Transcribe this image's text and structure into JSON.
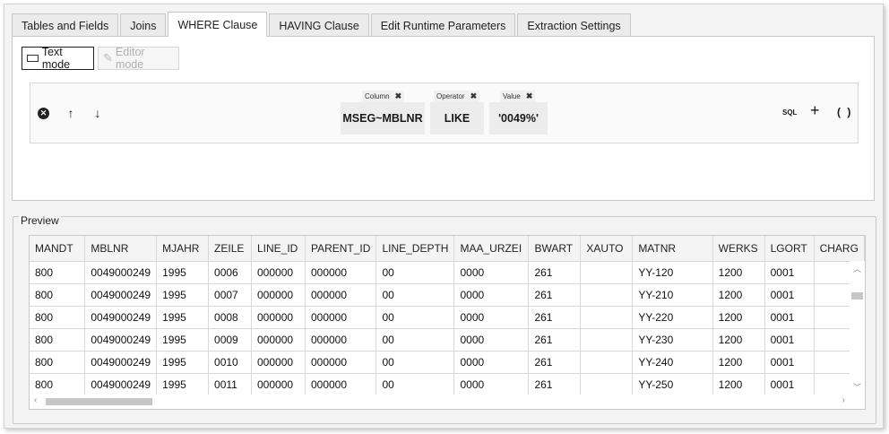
{
  "tabs": [
    {
      "label": "Tables and Fields"
    },
    {
      "label": "Joins"
    },
    {
      "label": "WHERE Clause"
    },
    {
      "label": "HAVING Clause"
    },
    {
      "label": "Edit Runtime Parameters"
    },
    {
      "label": "Extraction Settings"
    }
  ],
  "active_tab": "WHERE Clause",
  "mode": {
    "text_label": "Text mode",
    "editor_label": "Editor mode"
  },
  "condition": {
    "column_label": "Column",
    "column_value": "MSEG~MBLNR",
    "operator_label": "Operator",
    "operator_value": "LIKE",
    "value_label": "Value",
    "value_value": "'0049%'",
    "sql_label": "SQL",
    "plus_label": "+",
    "paren_label": "( )"
  },
  "preview": {
    "title": "Preview",
    "columns": [
      "MANDT",
      "MBLNR",
      "MJAHR",
      "ZEILE",
      "LINE_ID",
      "PARENT_ID",
      "LINE_DEPTH",
      "MAA_URZEI",
      "BWART",
      "XAUTO",
      "MATNR",
      "WERKS",
      "LGORT",
      "CHARG"
    ],
    "rows": [
      [
        "800",
        "0049000249",
        "1995",
        "0006",
        "000000",
        "000000",
        "00",
        "0000",
        "261",
        "",
        "YY-120",
        "1200",
        "0001",
        ""
      ],
      [
        "800",
        "0049000249",
        "1995",
        "0007",
        "000000",
        "000000",
        "00",
        "0000",
        "261",
        "",
        "YY-210",
        "1200",
        "0001",
        ""
      ],
      [
        "800",
        "0049000249",
        "1995",
        "0008",
        "000000",
        "000000",
        "00",
        "0000",
        "261",
        "",
        "YY-220",
        "1200",
        "0001",
        ""
      ],
      [
        "800",
        "0049000249",
        "1995",
        "0009",
        "000000",
        "000000",
        "00",
        "0000",
        "261",
        "",
        "YY-230",
        "1200",
        "0001",
        ""
      ],
      [
        "800",
        "0049000249",
        "1995",
        "0010",
        "000000",
        "000000",
        "00",
        "0000",
        "261",
        "",
        "YY-240",
        "1200",
        "0001",
        ""
      ],
      [
        "800",
        "0049000249",
        "1995",
        "0011",
        "000000",
        "000000",
        "00",
        "0000",
        "261",
        "",
        "YY-250",
        "1200",
        "0001",
        ""
      ]
    ]
  }
}
